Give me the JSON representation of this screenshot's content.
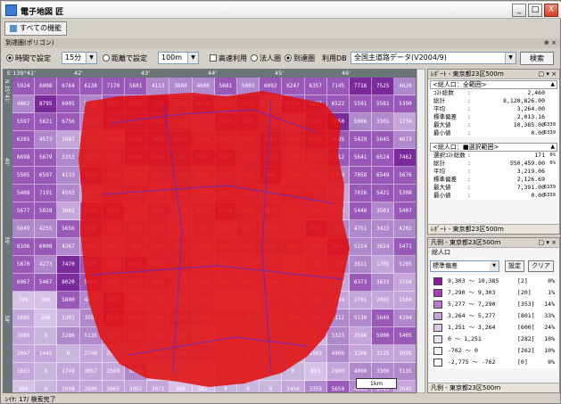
{
  "window": {
    "title": "電子地図 匠",
    "min": "_",
    "max": "□",
    "close": "X"
  },
  "toolbar": {
    "all_func_label": "すべての機能"
  },
  "panel": {
    "title": "到達圏(ポリゴン)",
    "pin": "⊕ ×"
  },
  "options": {
    "time_radio": "時間で設定",
    "time_value": "15分",
    "distance_radio": "距離で設定",
    "distance_value": "100m",
    "expressway_label": "高速利用",
    "legal_label": "法人圏",
    "reach_label": "到達圏",
    "data_label": "利用DB",
    "data_value": "全国主道路データ(V2004/9)",
    "search_label": "検索"
  },
  "map": {
    "top_coords": [
      "E 139°41'",
      "42'",
      "43'",
      "44'",
      "45'",
      "46'"
    ],
    "left_coords": [
      "N 35°41'",
      "40'",
      "39'",
      "38'"
    ],
    "scale_label": "1km",
    "grid_values": [
      [
        "5924",
        "6908",
        "6764",
        "6138",
        "7170",
        "5601",
        "4113",
        "3889",
        "4600",
        "5681",
        "5003",
        "6092",
        "6247",
        "6357",
        "7145",
        "7716",
        "7525",
        "4620"
      ],
      [
        "4862",
        "8795",
        "6905",
        "5261",
        "5557",
        "6809",
        "7391",
        "3393",
        "6020",
        "5109",
        "6157",
        "2652",
        "6274",
        "5457",
        "6522",
        "5591",
        "5581",
        "5390"
      ],
      [
        "5597",
        "5621",
        "6756",
        "3866",
        "5700",
        "6048",
        "5453",
        "3429",
        "2779",
        "5438",
        "7201",
        "4321",
        "1775",
        "5436",
        "8550",
        "5006",
        "3301",
        "1734"
      ],
      [
        "6285",
        "4573",
        "1687",
        "1537",
        "1648",
        "5766",
        "5649",
        "6716",
        "3534",
        "4700",
        "4943",
        "7059",
        "3434",
        "6196",
        "5695",
        "5429",
        "5645",
        "4673"
      ],
      [
        "6698",
        "5679",
        "3353",
        "3379",
        "3710",
        "6900",
        "6445",
        "5756",
        "5417",
        "5290",
        "4540",
        "6321",
        "2559",
        "3834",
        "6312",
        "5641",
        "6524",
        "7462"
      ],
      [
        "5505",
        "6597",
        "4133",
        "5514",
        "3543",
        "2200",
        "5145",
        "4186",
        "3062",
        "4540",
        "4692",
        "7007",
        "2746",
        "1800",
        "4303",
        "7058",
        "6549",
        "5676"
      ],
      [
        "5408",
        "7191",
        "4593",
        "2519",
        "4694",
        "4038",
        "2315",
        "3449",
        "2650",
        "4931",
        "4050",
        "3193",
        "4206",
        "3373",
        "2564",
        "7016",
        "5421",
        "5308"
      ],
      [
        "5677",
        "5928",
        "3062",
        "6230",
        "6806",
        "1947",
        "4061",
        "2613",
        "4376",
        "6156",
        "4067",
        "3817",
        "1595",
        "2991",
        "3218",
        "5446",
        "3503",
        "5407"
      ],
      [
        "5049",
        "4255",
        "5656",
        "5760",
        "4654",
        "4660",
        "5034",
        "3005",
        "5056",
        "3234",
        "5021",
        "1690",
        "2261",
        "6037",
        "3267",
        "4751",
        "3423",
        "4202"
      ],
      [
        "6106",
        "6008",
        "4267",
        "3522",
        "3020",
        "4804",
        "5245",
        "5272",
        "2990",
        "3467",
        "3562",
        "3505",
        "3378",
        "2809",
        "5831",
        "5224",
        "3624",
        "5471"
      ],
      [
        "5870",
        "4273",
        "7470",
        "6170",
        "5024",
        "6083",
        "4756",
        "4516",
        "1676",
        "1347",
        "1540",
        "2763",
        "1205",
        "1318",
        "3753",
        "3811",
        "1705",
        "5205"
      ],
      [
        "6067",
        "5467",
        "8020",
        "5668",
        "4291",
        "4911",
        "4466",
        "2178",
        "1780",
        "1441",
        "2064",
        "1630",
        "1637",
        "2179",
        "2112",
        "6373",
        "3633",
        "3104"
      ],
      [
        "709",
        "306",
        "5800",
        "4437",
        "5613",
        "2980",
        "1687",
        "1498",
        "1821",
        "503",
        "809",
        "3022",
        "1365",
        "1419",
        "1284",
        "1701",
        "2065",
        "1564"
      ],
      [
        "1695",
        "296",
        "1301",
        "3552",
        "6870",
        "4123",
        "1758",
        "3705",
        "2990",
        "0",
        "0",
        "0",
        "1800",
        "1365",
        "4112",
        "5130",
        "5649",
        "4294"
      ],
      [
        "3086",
        "0",
        "3286",
        "5135",
        "4577",
        "3950",
        "2168",
        "1402",
        "998",
        "0",
        "0",
        "0",
        "0",
        "0",
        "3323",
        "2596",
        "5900",
        "5405"
      ],
      [
        "2007",
        "1445",
        "0",
        "2740",
        "2573",
        "3028",
        "2035",
        "1608",
        "2271",
        "0",
        "0",
        "0",
        "0",
        "1903",
        "4006",
        "3206",
        "3125",
        "3095"
      ],
      [
        "1663",
        "0",
        "1749",
        "3057",
        "2569",
        "5010",
        "1205",
        "1114",
        "1210",
        "0",
        "0",
        "0",
        "0",
        "893",
        "2900",
        "4090",
        "3300",
        "5135"
      ],
      [
        "386",
        "0",
        "2998",
        "2690",
        "3065",
        "3002",
        "2071",
        "998",
        "587",
        "0",
        "0",
        "0",
        "1450",
        "3359",
        "5650",
        "4055",
        "3745",
        "2645"
      ]
    ]
  },
  "status": {
    "text": "ﾚｲﾔ: 17/  検索完了"
  },
  "report": {
    "title": "ﾚﾎﾟｰﾄ - 東京都23区500ｍ",
    "ctl": "□ ▾ ×",
    "total_section": "<総人口：全範囲>",
    "total_rows": [
      {
        "k": "ｺｽﾄ総数",
        "v": "2,460",
        "u": ""
      },
      {
        "k": "総計",
        "v": "8,120,826.00",
        "u": ""
      },
      {
        "k": "平均",
        "v": "3,264.00",
        "u": ""
      },
      {
        "k": "標準偏差",
        "v": "2,013.16",
        "u": ""
      },
      {
        "k": "最大値",
        "v": "10,385.00",
        "u": "5339"
      },
      {
        "k": "最小値",
        "v": "0.00",
        "u": "5339"
      }
    ],
    "sel_section": "<総人口：■選択範囲>",
    "sel_rows": [
      {
        "k": "選択ｺｽﾄ総数",
        "v": "171",
        "u": "6%"
      },
      {
        "k": "総計",
        "v": "550,459.00",
        "u": "6%"
      },
      {
        "k": "平均",
        "v": "3,219.06",
        "u": ""
      },
      {
        "k": "標準偏差",
        "v": "2,126.69",
        "u": ""
      },
      {
        "k": "最大値",
        "v": "7,391.00",
        "u": "5339"
      },
      {
        "k": "最小値",
        "v": "0.00",
        "u": "5339"
      }
    ],
    "footer": "ﾚﾎﾟｰﾄ - 東京都23区500ｍ"
  },
  "legend": {
    "title": "凡例 - 東京都23区500ｍ",
    "ctl": "□ ▾ ×",
    "field": "総人口",
    "method": "標準偏差",
    "set_button": "設定",
    "clear_button": "クリア",
    "rows": [
      {
        "range": "9,303 ～ 10,385",
        "count": "[2]",
        "pct": "0%",
        "color": "#8a1a9a"
      },
      {
        "range": "7,290 ～ 9,303",
        "count": "[20]",
        "pct": "1%",
        "color": "#a540b8"
      },
      {
        "range": "5,277 ～ 7,290",
        "count": "[353]",
        "pct": "14%",
        "color": "#b878cc"
      },
      {
        "range": "3,264 ～ 5,277",
        "count": "[801]",
        "pct": "33%",
        "color": "#c8a0dc"
      },
      {
        "range": "1,251 ～ 3,264",
        "count": "[600]",
        "pct": "24%",
        "color": "#dcc4ea"
      },
      {
        "range": "0 ～ 1,251",
        "count": "[282]",
        "pct": "10%",
        "color": "#ece0f4"
      },
      {
        "range": "-762 ～ 0",
        "count": "[262]",
        "pct": "10%",
        "color": "#f6f0fa"
      },
      {
        "range": "-2,775 ～ -762",
        "count": "[0]",
        "pct": "0%",
        "color": "#ffffff"
      }
    ],
    "footer": "凡例 - 東京都23区500ｍ"
  },
  "colors": {
    "reach_fill": "#e01010",
    "purple_dark": "#6a2a8a",
    "purple_light": "#c8a0dc"
  }
}
